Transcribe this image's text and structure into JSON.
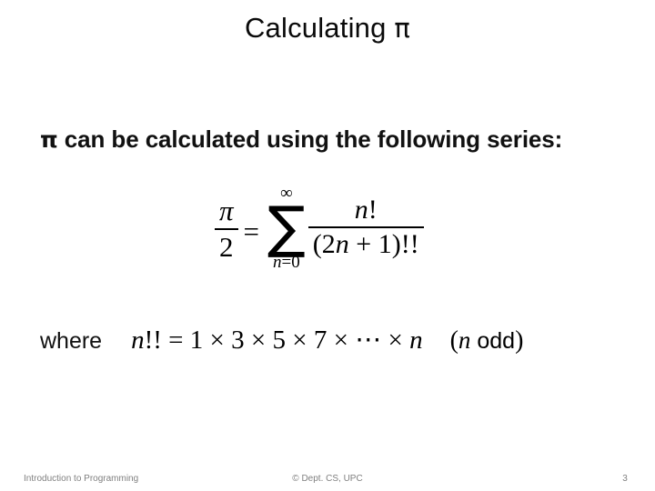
{
  "slide": {
    "title_text": "Calculating ",
    "title_symbol": "π",
    "background": "#ffffff",
    "text_color": "#000000"
  },
  "body": {
    "bullet_symbol": "π",
    "bullet_text": " can be calculated using the following series:"
  },
  "equation": {
    "description": "pi/2 = sum from n=0 to infinity of n! / (2n+1)!!",
    "left_fraction": {
      "numerator": "π",
      "denominator": "2"
    },
    "relation": "=",
    "summation": {
      "symbol": "∑",
      "upper_limit": "∞",
      "lower_limit_variable": "n",
      "lower_limit_equals": "=",
      "lower_limit_value": "0",
      "lower_limit": "n=0"
    },
    "term_fraction": {
      "numerator_variable": "n",
      "numerator_factorial": "!",
      "numerator": "n!",
      "denominator_open": "(",
      "denominator_coeff": "2",
      "denominator_variable": "n",
      "denominator_plus": " + ",
      "denominator_one": "1",
      "denominator_close": ")",
      "denominator_doublefactorial": "!!",
      "denominator": "(2n + 1)!!"
    }
  },
  "where": {
    "label": "where",
    "definition_variable": "n",
    "definition_doublefactorial": "!!",
    "definition_equals": " = ",
    "definition_terms": "1 × 3 × 5 × 7 × ⋯ × ",
    "definition_last_variable": "n",
    "definition": "n!! = 1 × 3 × 5 × 7 × ⋯ × n",
    "condition_open": "(",
    "condition_variable": "n",
    "condition_word": " odd",
    "condition_close": ")",
    "condition": "(n odd)"
  },
  "footer": {
    "left": "Introduction to Programming",
    "center": "© Dept. CS, UPC",
    "page_number": "3",
    "color": "#7f7f7f"
  }
}
